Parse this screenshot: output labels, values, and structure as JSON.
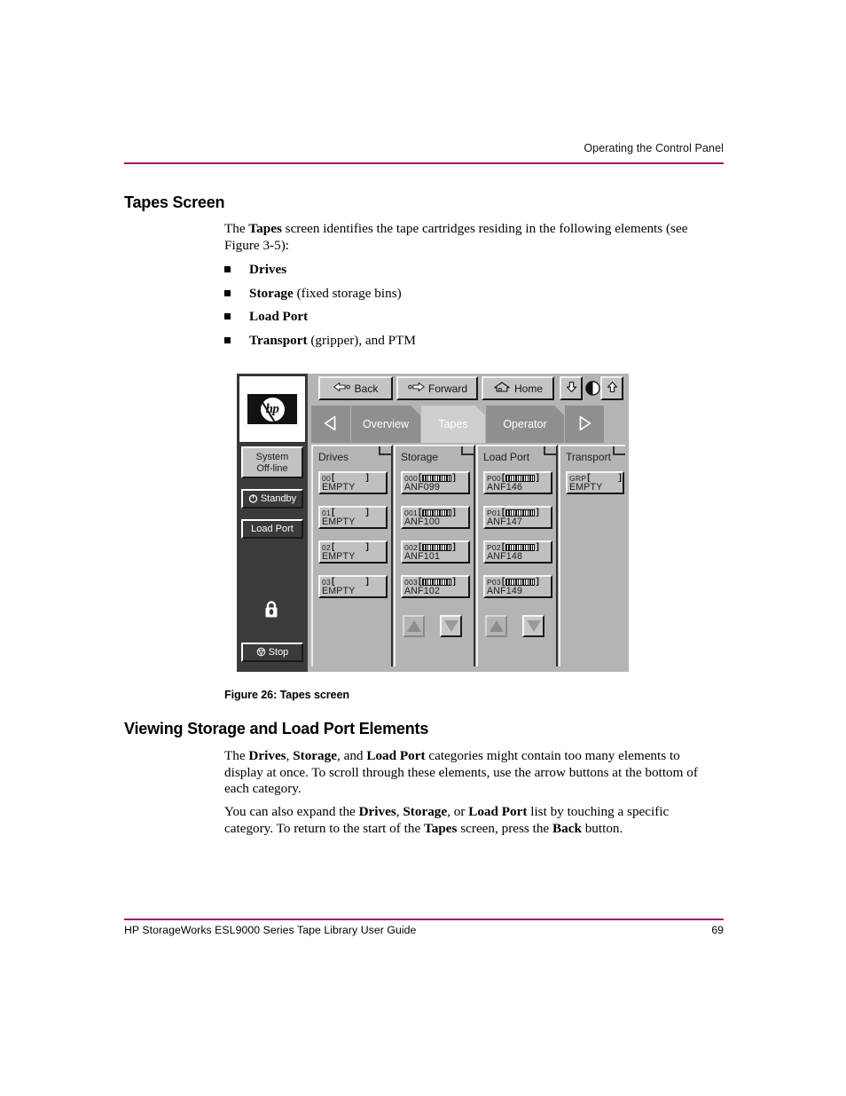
{
  "page": {
    "running_head": "Operating the Control Panel",
    "footer_title": "HP StorageWorks ESL9000 Series Tape Library User Guide",
    "page_number": "69",
    "rule_color": "#9c1a6c"
  },
  "section_tapes": {
    "heading": "Tapes Screen",
    "intro_html": "The <b>Tapes</b> screen identifies the tape cartridges residing in the following elements (see Figure 3-5):",
    "bullets": [
      {
        "html": "<b>Drives</b>"
      },
      {
        "html": "<b>Storage</b> (fixed storage bins)"
      },
      {
        "html": "<b>Load Port</b>"
      },
      {
        "html": "<b>Transport</b> (gripper), and PTM"
      }
    ]
  },
  "figure": {
    "caption": "Figure 26:  Tapes screen"
  },
  "section_viewing": {
    "heading": "Viewing Storage and Load Port Elements",
    "para1_html": "The <b>Drives</b>, <b>Storage</b>, and <b>Load Port</b> categories might contain too many elements to display at once. To scroll through these elements, use the arrow buttons at the bottom of each category.",
    "para2_html": "You can also expand the <b>Drives</b>, <b>Storage</b>, or <b>Load Port</b> list by touching a specific category. To return to the start of the <b>Tapes</b> screen, press the <b>Back</b> button."
  },
  "control_panel": {
    "logo_text": "hp",
    "rail": {
      "status_line1": "System",
      "status_line2": "Off-line",
      "standby_label": "Standby",
      "loadport_label": "Load Port",
      "stop_label": "Stop",
      "lock_icon": "lock-icon",
      "dark_color": "#3b3b3b"
    },
    "toolbar": {
      "back_label": "Back",
      "forward_label": "Forward",
      "home_label": "Home",
      "contrast_down_icon": "contrast-down-icon",
      "contrast_indicator_icon": "contrast-level-icon",
      "contrast_up_icon": "contrast-up-icon"
    },
    "tabs": {
      "prev_icon": "triangle-left-icon",
      "next_icon": "triangle-right-icon",
      "items": [
        {
          "label": "Overview",
          "active": false
        },
        {
          "label": "Tapes",
          "active": true
        },
        {
          "label": "Operator",
          "active": false
        }
      ]
    },
    "columns": [
      {
        "title": "Drives",
        "has_scroll": false,
        "cells": [
          {
            "id": "00",
            "barcode": false,
            "label": "EMPTY"
          },
          {
            "id": "01",
            "barcode": false,
            "label": "EMPTY"
          },
          {
            "id": "02",
            "barcode": false,
            "label": "EMPTY"
          },
          {
            "id": "03",
            "barcode": false,
            "label": "EMPTY"
          }
        ]
      },
      {
        "title": "Storage",
        "has_scroll": true,
        "cells": [
          {
            "id": "000",
            "barcode": true,
            "label": "ANF099"
          },
          {
            "id": "001",
            "barcode": true,
            "label": "ANF100"
          },
          {
            "id": "002",
            "barcode": true,
            "label": "ANF101"
          },
          {
            "id": "003",
            "barcode": true,
            "label": "ANF102"
          }
        ]
      },
      {
        "title": "Load Port",
        "has_scroll": true,
        "cells": [
          {
            "id": "P00",
            "barcode": true,
            "label": "ANF146"
          },
          {
            "id": "P01",
            "barcode": true,
            "label": "ANF147"
          },
          {
            "id": "P02",
            "barcode": true,
            "label": "ANF148"
          },
          {
            "id": "P03",
            "barcode": true,
            "label": "ANF149"
          }
        ]
      },
      {
        "title": "Transport",
        "has_scroll": false,
        "cells": [
          {
            "id": "GRP",
            "barcode": false,
            "label": "EMPTY"
          }
        ]
      }
    ],
    "scroll": {
      "up_icon": "triangle-up-icon",
      "down_icon": "triangle-down-icon"
    }
  }
}
